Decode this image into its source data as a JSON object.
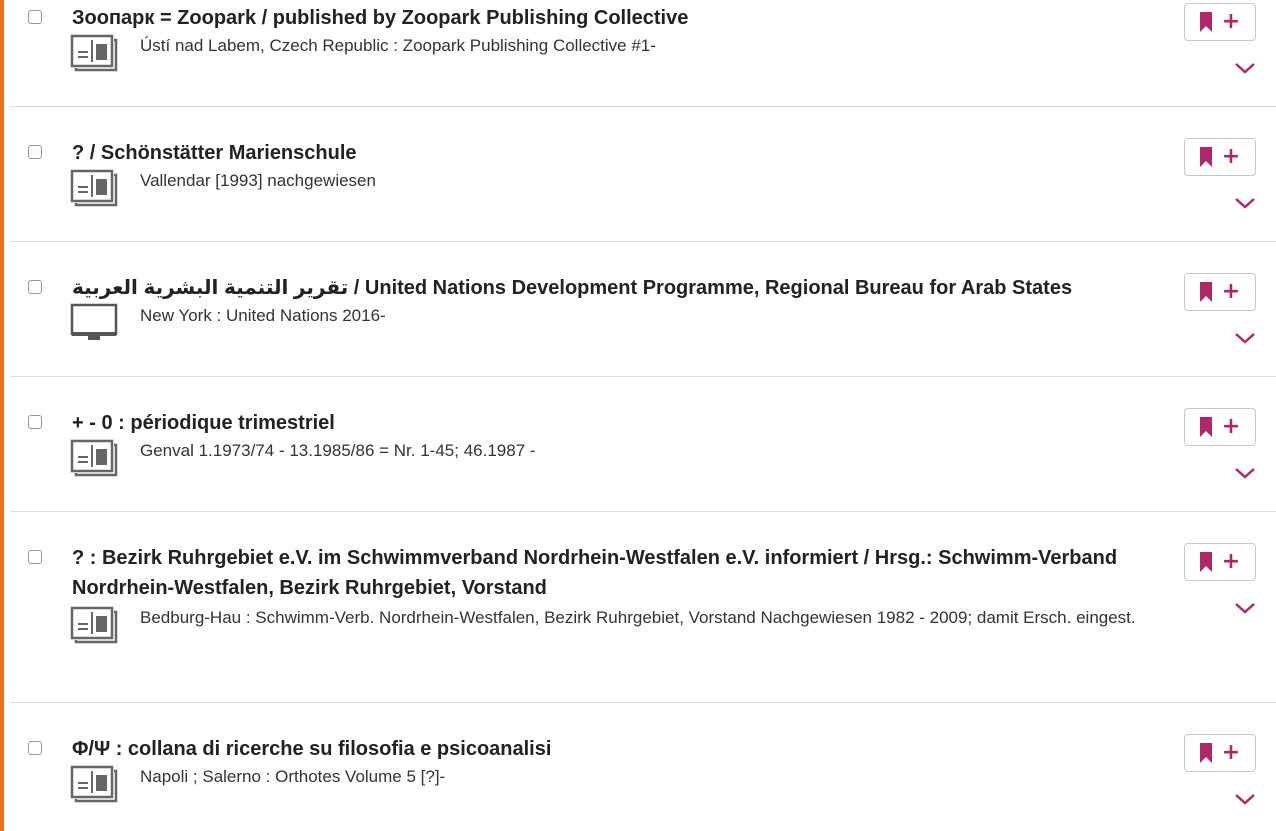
{
  "results": [
    {
      "title": "Зоопарк = Zoopark / published by Zoopark Publishing Collective",
      "details": "Ústí nad Labem, Czech Republic : Zoopark Publishing Collective #1-",
      "media_icon": "newspaper-icon"
    },
    {
      "title": "? / Schönstätter Marienschule",
      "details": "Vallendar [1993] nachgewiesen",
      "media_icon": "newspaper-icon"
    },
    {
      "title": "تقرير التنمية البشرية العربية / United Nations Development Programme, Regional Bureau for Arab States",
      "details": "New York : United Nations 2016-",
      "media_icon": "computer-monitor-icon"
    },
    {
      "title": "+ - 0 : périodique trimestriel",
      "details": "Genval 1.1973/74 - 13.1985/86 = Nr. 1-45; 46.1987 -",
      "media_icon": "newspaper-icon"
    },
    {
      "title": "? : Bezirk Ruhrgebiet e.V. im Schwimmverband Nordrhein-Westfalen e.V. informiert / Hrsg.: Schwimm-Verband Nordrhein-Westfalen, Bezirk Ruhrgebiet, Vorstand",
      "details": "Bedburg-Hau : Schwimm-Verb. Nordrhein-Westfalen, Bezirk Ruhrgebiet, Vorstand Nachgewiesen 1982 - 2009; damit Ersch. eingest.",
      "media_icon": "newspaper-icon"
    },
    {
      "title": "Φ/Ψ : collana di ricerche su filosofia e psicoanalisi",
      "details": "Napoli ; Salerno : Orthotes Volume 5 [?]-",
      "media_icon": "newspaper-icon"
    }
  ],
  "bookmark_button": {
    "plus": "+",
    "icon": "bookmark-icon"
  },
  "expand_icon": "chevron-down-icon",
  "colors": {
    "accent": "#e8731e",
    "bookmark": "#b0266b",
    "border": "#dedede",
    "icon": "#666666"
  }
}
